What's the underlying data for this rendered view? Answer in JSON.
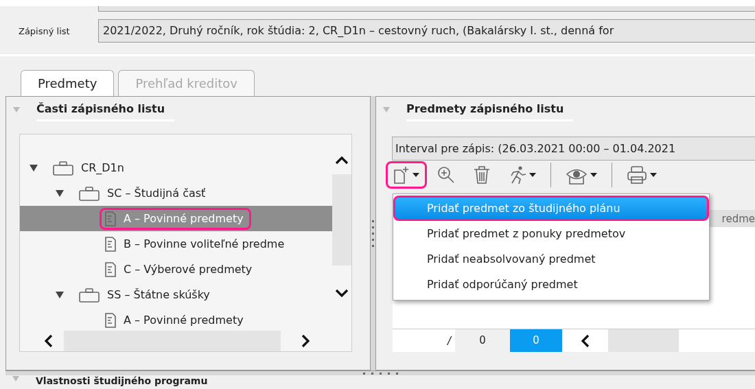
{
  "enrollment": {
    "label": "Zápisný list",
    "value": "2021/2022, Druhý ročník, rok štúdia: 2, CR_D1n – cestovný ruch, (Bakalársky I. st., denná for"
  },
  "tabs": [
    {
      "label": "Predmety",
      "selected": true
    },
    {
      "label": "Prehľad kreditov",
      "selected": false
    }
  ],
  "parts_panel": {
    "title": "Časti zápisného listu",
    "tree": [
      {
        "label": "CR_D1n",
        "kind": "folder",
        "expanded": true,
        "selected": false,
        "highlighted": false,
        "children": [
          {
            "label": "SC – Študijná časť",
            "kind": "folder",
            "expanded": true,
            "selected": false,
            "highlighted": false,
            "children": [
              {
                "label": "A – Povinné predmety",
                "kind": "document",
                "selected": true,
                "highlighted": true
              },
              {
                "label": "B – Povinne voliteľné predme",
                "kind": "document",
                "selected": false,
                "highlighted": false
              },
              {
                "label": "C – Výberové predmety",
                "kind": "document",
                "selected": false,
                "highlighted": false
              }
            ]
          },
          {
            "label": "SS – Štátne skúšky",
            "kind": "folder",
            "expanded": true,
            "selected": false,
            "highlighted": false,
            "children": [
              {
                "label": "A – Povinné predmety",
                "kind": "document",
                "selected": false,
                "highlighted": false
              }
            ]
          }
        ]
      }
    ]
  },
  "subjects_panel": {
    "title": "Predmety zápisného listu",
    "interval": "Interval pre zápis: (26.03.2021 00:00 – 01.04.2021",
    "toolbar": [
      {
        "kind": "add",
        "dropdown": true,
        "highlighted": true
      },
      {
        "kind": "zoom",
        "dropdown": false,
        "highlighted": false
      },
      {
        "kind": "delete",
        "dropdown": false,
        "highlighted": false
      },
      {
        "kind": "run",
        "dropdown": true,
        "highlighted": false
      },
      {
        "kind": "separator"
      },
      {
        "kind": "view",
        "dropdown": true,
        "highlighted": false
      },
      {
        "kind": "separator"
      },
      {
        "kind": "print",
        "dropdown": true,
        "highlighted": false
      }
    ],
    "table": {
      "columns": [
        "redme"
      ]
    },
    "pager": {
      "separator": "/",
      "total": "0",
      "current": "0"
    },
    "add_menu": [
      {
        "label": "Pridať predmet zo študijného plánu",
        "selected": true,
        "highlighted": true
      },
      {
        "label": "Pridať predmet z ponuky predmetov",
        "selected": false,
        "highlighted": false
      },
      {
        "label": "Pridať neabsolvovaný predmet",
        "selected": false,
        "highlighted": false
      },
      {
        "label": "Pridať odporúčaný predmet",
        "selected": false,
        "highlighted": false
      }
    ]
  },
  "properties_panel": {
    "title": "Vlastnosti študijného programu"
  }
}
